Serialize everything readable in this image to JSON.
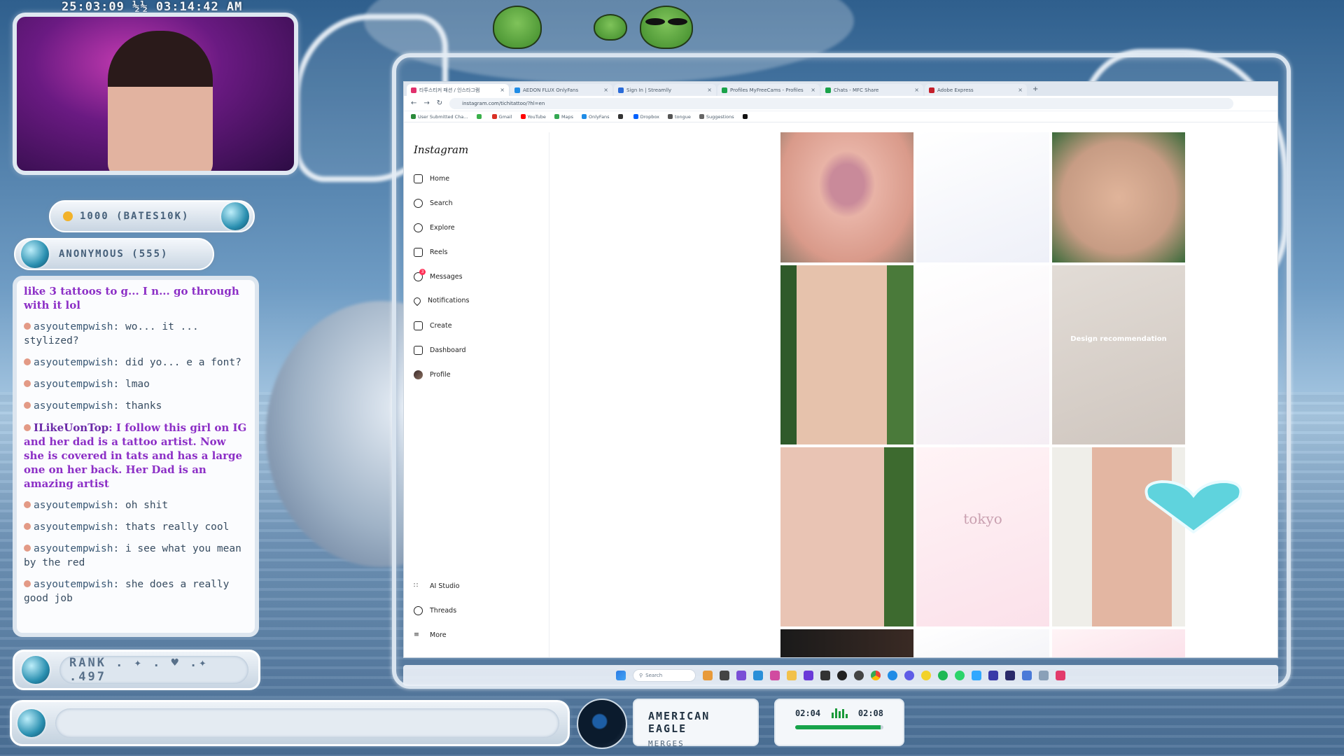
{
  "overlay": {
    "timestamp": "25:03:09 ½½ 03:14:42 AM",
    "follower_goal": "1000 (BATES10K)",
    "last_donor": "ANONYMOUS (555)",
    "rank": "RANK . ✦ . ♥ .✦ .497"
  },
  "chat": {
    "messages": [
      {
        "user": "",
        "text": "like 3 tattoos to g... I n... go through with it lol",
        "highlight": true,
        "color": "#8c2fc6"
      },
      {
        "user": "asyoutempwish",
        "text": ": wo... it ... stylized?"
      },
      {
        "user": "asyoutempwish",
        "text": ": did yo... e a font?"
      },
      {
        "user": "asyoutempwish",
        "text": ": lmao"
      },
      {
        "user": "asyoutempwish",
        "text": ": thanks"
      },
      {
        "user": "ILikeUonTop",
        "text": ": I follow this girl on IG and her dad is a tattoo artist. Now she is covered in tats and has a large one on her back. Her Dad is an amazing artist",
        "highlight": true
      },
      {
        "user": "asyoutempwish",
        "text": ": oh shit"
      },
      {
        "user": "asyoutempwish",
        "text": ": thats really cool"
      },
      {
        "user": "asyoutempwish",
        "text": ": i see what you mean by the red"
      },
      {
        "user": "asyoutempwish",
        "text": ": she does a really good job"
      }
    ]
  },
  "music": {
    "title": "AMERICAN EAGLE",
    "artist": "MERGES",
    "elapsed": "02:04",
    "total": "02:08",
    "progress": 0.97
  },
  "browser": {
    "tabs": [
      {
        "label": "타투스티커 패션 / 인스타그램",
        "active": true,
        "color": "#e1306c"
      },
      {
        "label": "AEDON FLUX OnlyFans",
        "active": false,
        "color": "#1f8ce6"
      },
      {
        "label": "Sign In | Streamlly",
        "active": false,
        "color": "#2a6bd8"
      },
      {
        "label": "Profiles MyFreeCams - Profiles",
        "active": false,
        "color": "#1aa34a"
      },
      {
        "label": "Chats - MFC Share",
        "active": false,
        "color": "#1aa34a"
      },
      {
        "label": "Adobe Express",
        "active": false,
        "color": "#c41f2a"
      }
    ],
    "url": "instagram.com/tichitattoo/?hl=en",
    "bookmarks": [
      {
        "label": "User Submitted Cha...",
        "color": "#2a8a3a"
      },
      {
        "label": "",
        "color": "#3ab04a"
      },
      {
        "label": "Gmail",
        "color": "#d93025"
      },
      {
        "label": "YouTube",
        "color": "#ff0000"
      },
      {
        "label": "Maps",
        "color": "#34a853"
      },
      {
        "label": "OnlyFans",
        "color": "#1f8ce6"
      },
      {
        "label": "",
        "color": "#333333"
      },
      {
        "label": "Dropbox",
        "color": "#0061fe"
      },
      {
        "label": "tongue",
        "color": "#555555"
      },
      {
        "label": "Suggestions",
        "color": "#666666"
      },
      {
        "label": "",
        "color": "#111111"
      }
    ]
  },
  "instagram": {
    "logo": "Instagram",
    "nav": [
      {
        "label": "Home",
        "icon": "home-icon"
      },
      {
        "label": "Search",
        "icon": "search-icon"
      },
      {
        "label": "Explore",
        "icon": "compass-icon"
      },
      {
        "label": "Reels",
        "icon": "reels-icon"
      },
      {
        "label": "Messages",
        "icon": "messenger-icon",
        "badge": "3"
      },
      {
        "label": "Notifications",
        "icon": "heart-icon"
      },
      {
        "label": "Create",
        "icon": "plus-square-icon"
      },
      {
        "label": "Dashboard",
        "icon": "dashboard-icon"
      },
      {
        "label": "Profile",
        "icon": "avatar"
      }
    ],
    "bottom_nav": [
      {
        "label": "AI Studio",
        "icon": "ai-studio-icon"
      },
      {
        "label": "Threads",
        "icon": "threads-icon"
      },
      {
        "label": "More",
        "icon": "menu-icon"
      }
    ],
    "posts": [
      {
        "caption": "",
        "theme": "luna moth tattoo"
      },
      {
        "caption": "",
        "theme": "floral flash sketch"
      },
      {
        "caption": "",
        "theme": "bear tattoo on forearm"
      },
      {
        "caption": "",
        "theme": "flower tattoo on arm"
      },
      {
        "caption": "",
        "theme": "bow flash sketch"
      },
      {
        "caption": "Design recommendation",
        "theme": "purple line designs"
      },
      {
        "caption": "",
        "theme": "red ribbon tattoo"
      },
      {
        "caption": "tokyo",
        "theme": "pink bow flash"
      },
      {
        "caption": "",
        "theme": "pink flower shoulder tattoo"
      },
      {
        "caption": "",
        "theme": "partial row"
      },
      {
        "caption": "",
        "theme": "partial row"
      },
      {
        "caption": "",
        "theme": "partial row"
      }
    ]
  },
  "taskbar": {
    "search_placeholder": "Search"
  }
}
